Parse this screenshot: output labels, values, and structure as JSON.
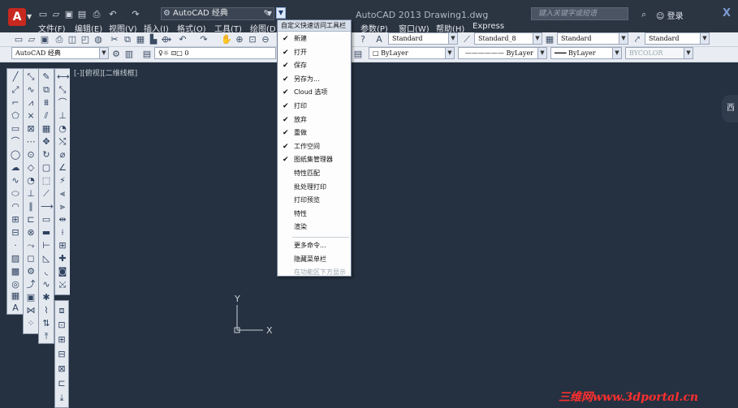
{
  "title_bar": {
    "app_button_label": "A",
    "workspace_combo_value": "AutoCAD 经典",
    "window_title": "AutoCAD 2013   Drawing1.dwg",
    "search_placeholder": "键入关键字或短语",
    "login_label": "登录",
    "close_label": "X"
  },
  "menu_bar": {
    "items": [
      "文件(F)",
      "编辑(E)",
      "视图(V)",
      "插入(I)",
      "格式(O)",
      "工具(T)",
      "绘图(D)",
      "参数(P)",
      "窗口(W)",
      "帮助(H)",
      "Express"
    ]
  },
  "standard_toolbar": {
    "text_style_combo": "Standard",
    "dim_style_combo": "Standard_8",
    "table_style_combo": "Standard",
    "multileader_style_combo": "Standard"
  },
  "layers_toolbar": {
    "workspace_combo": "AutoCAD 经典",
    "layer_combo": "0",
    "color_combo": "ByLayer",
    "linetype_combo": "ByLayer",
    "lineweight_combo": "ByLayer",
    "plotstyle_combo": "BYCOLOR"
  },
  "drawing_area": {
    "viewport_label": "[-][俯视][二维线框]",
    "ucs_y_label": "Y",
    "ucs_x_label": "X",
    "side_fragment": "西",
    "watermark": "三维网www.3dportal.cn"
  },
  "qat_menu": {
    "header": "自定义快速访问工具栏",
    "items": [
      {
        "label": "新建",
        "checked": true,
        "disabled": false
      },
      {
        "label": "打开",
        "checked": true,
        "disabled": false
      },
      {
        "label": "保存",
        "checked": true,
        "disabled": false
      },
      {
        "label": "另存为...",
        "checked": true,
        "disabled": false
      },
      {
        "label": "Cloud 选项",
        "checked": true,
        "disabled": false
      },
      {
        "label": "打印",
        "checked": true,
        "disabled": false
      },
      {
        "label": "放弃",
        "checked": true,
        "disabled": false
      },
      {
        "label": "重做",
        "checked": true,
        "disabled": false
      },
      {
        "label": "工作空间",
        "checked": true,
        "disabled": false
      },
      {
        "label": "图纸集管理器",
        "checked": true,
        "disabled": false
      },
      {
        "label": "特性匹配",
        "checked": false,
        "disabled": false
      },
      {
        "label": "批处理打印",
        "checked": false,
        "disabled": false
      },
      {
        "label": "打印预览",
        "checked": false,
        "disabled": false
      },
      {
        "label": "特性",
        "checked": false,
        "disabled": false
      },
      {
        "label": "渲染",
        "checked": false,
        "disabled": false
      },
      {
        "label": "更多命令...",
        "checked": false,
        "disabled": false
      },
      {
        "label": "隐藏菜单栏",
        "checked": false,
        "disabled": false
      },
      {
        "label": "在功能区下方显示",
        "checked": false,
        "disabled": true
      }
    ],
    "check_glyph": "✔"
  },
  "colors": {
    "title_bar": "#2b3441",
    "canvas": "#253140",
    "toolbar": "#e9edf3",
    "watermark": "#ff2f2f"
  },
  "icons": {
    "qat": [
      "new-icon",
      "open-icon",
      "save-icon",
      "save-as-icon",
      "print-icon",
      "undo-icon",
      "redo-icon"
    ],
    "draw_toolbar": [
      "line-icon",
      "construction-line-icon",
      "polyline-icon",
      "polygon-icon",
      "rectangle-icon",
      "arc-icon",
      "circle-icon",
      "revision-cloud-icon",
      "spline-icon",
      "ellipse-icon",
      "ellipse-arc-icon",
      "insert-block-icon",
      "make-block-icon",
      "point-icon",
      "hatch-icon",
      "gradient-icon",
      "region-icon",
      "table-icon",
      "multiline-text-icon"
    ]
  }
}
